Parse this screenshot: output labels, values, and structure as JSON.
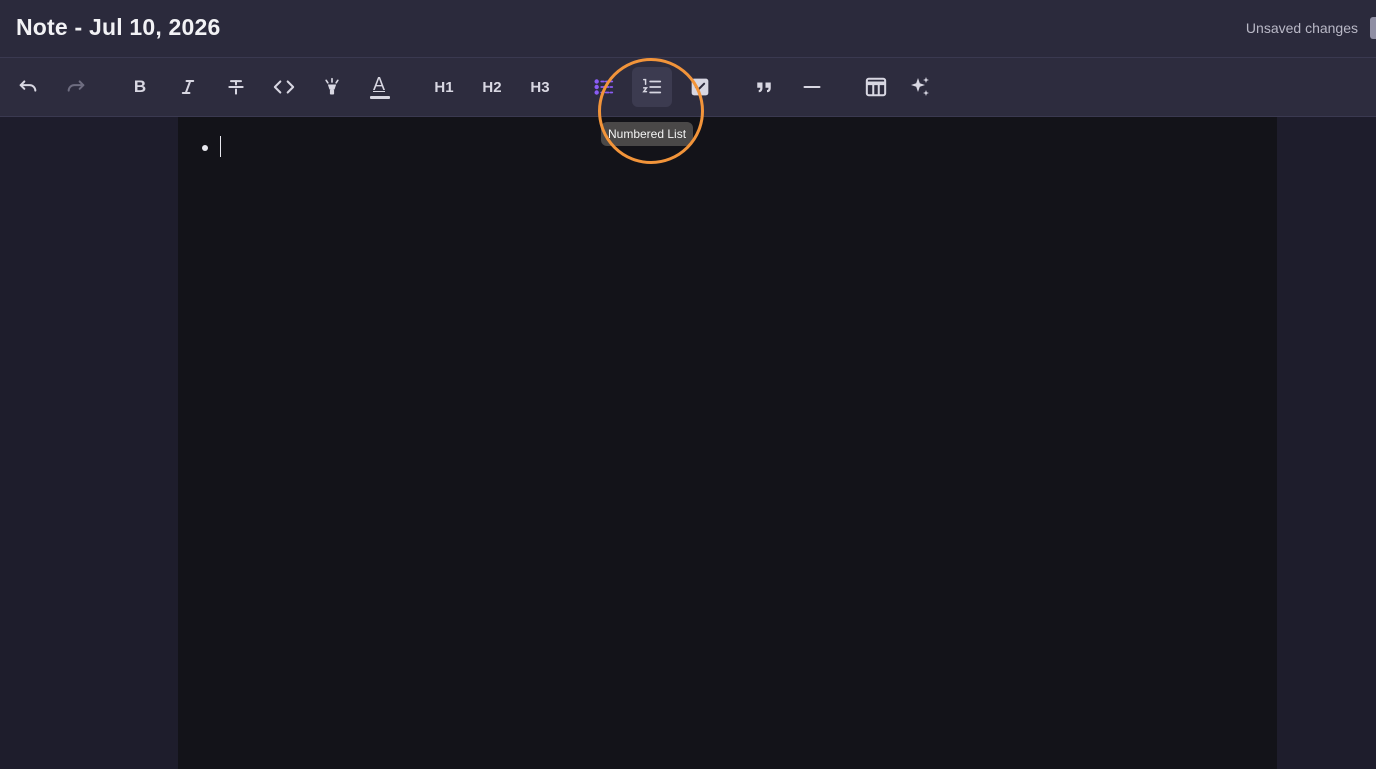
{
  "titlebar": {
    "title": "Note - Jul 10, 2026",
    "status": "Unsaved changes"
  },
  "toolbar": {
    "undo": {
      "icon": "undo-icon",
      "enabled": true
    },
    "redo": {
      "icon": "redo-icon",
      "enabled": false
    },
    "bold": {
      "icon": "bold-icon",
      "label": "B"
    },
    "italic": {
      "icon": "italic-icon"
    },
    "strikethrough": {
      "icon": "strikethrough-icon"
    },
    "code": {
      "icon": "code-icon"
    },
    "highlight": {
      "icon": "highlight-icon"
    },
    "text_color": {
      "icon": "text-color-icon",
      "label": "A"
    },
    "h1": {
      "label": "H1"
    },
    "h2": {
      "label": "H2"
    },
    "h3": {
      "label": "H3"
    },
    "bulleted_list": {
      "icon": "bulleted-list-icon",
      "active": true,
      "color": "#8a5cf5"
    },
    "numbered_list": {
      "icon": "numbered-list-icon",
      "hovered": true
    },
    "checklist": {
      "icon": "checklist-icon"
    },
    "quote": {
      "icon": "quote-icon"
    },
    "divider": {
      "icon": "horizontal-rule-icon"
    },
    "table": {
      "icon": "table-icon"
    },
    "ai": {
      "icon": "sparkles-icon"
    }
  },
  "tooltip": {
    "text": "Numbered List"
  },
  "editor": {
    "content": "",
    "list_type": "bulleted"
  },
  "colors": {
    "titlebar_bg": "#2b2a3c",
    "toolbar_bg": "#2d2c3e",
    "editor_bg": "#131319",
    "accent": "#8a5cf5",
    "highlight_ring": "#f2943a"
  }
}
